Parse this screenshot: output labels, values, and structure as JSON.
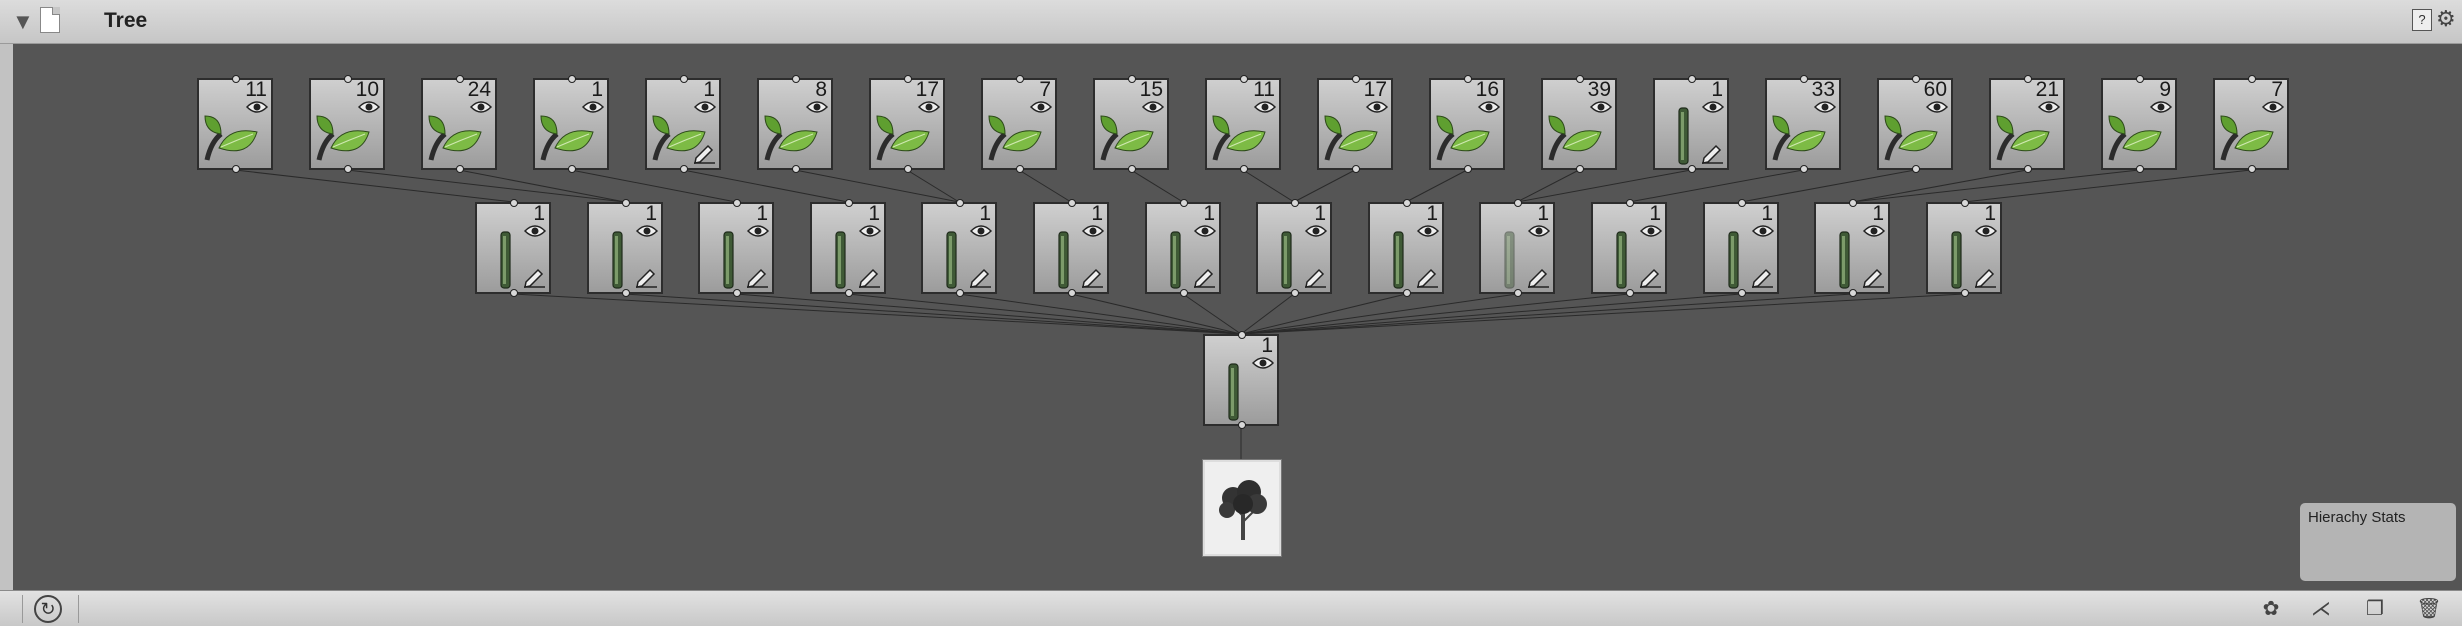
{
  "header": {
    "title": "Tree",
    "foldout_glyph": "▼",
    "help_glyph": "?",
    "gear_glyph": "⚙"
  },
  "stats": {
    "label": "Hierachy Stats"
  },
  "footer": {
    "refresh_glyph": "↻",
    "tools": [
      {
        "name": "add-leaf-group-icon",
        "glyph": "✿"
      },
      {
        "name": "add-branch-group-icon",
        "glyph": "⋌"
      },
      {
        "name": "duplicate-icon",
        "glyph": "❐"
      },
      {
        "name": "delete-icon",
        "glyph": "🗑"
      }
    ]
  },
  "leaf_row": [
    {
      "count": "11",
      "type": "leaf"
    },
    {
      "count": "10",
      "type": "leaf"
    },
    {
      "count": "24",
      "type": "leaf"
    },
    {
      "count": "1",
      "type": "leaf"
    },
    {
      "count": "1",
      "type": "leaf",
      "edited": true
    },
    {
      "count": "8",
      "type": "leaf"
    },
    {
      "count": "17",
      "type": "leaf"
    },
    {
      "count": "7",
      "type": "leaf"
    },
    {
      "count": "15",
      "type": "leaf"
    },
    {
      "count": "11",
      "type": "leaf"
    },
    {
      "count": "17",
      "type": "leaf"
    },
    {
      "count": "16",
      "type": "leaf"
    },
    {
      "count": "39",
      "type": "leaf"
    },
    {
      "count": "1",
      "type": "branch",
      "edited": true
    },
    {
      "count": "33",
      "type": "leaf"
    },
    {
      "count": "60",
      "type": "leaf"
    },
    {
      "count": "21",
      "type": "leaf"
    },
    {
      "count": "9",
      "type": "leaf"
    },
    {
      "count": "7",
      "type": "leaf"
    }
  ],
  "branch_row": [
    {
      "count": "1"
    },
    {
      "count": "1"
    },
    {
      "count": "1"
    },
    {
      "count": "1"
    },
    {
      "count": "1"
    },
    {
      "count": "1"
    },
    {
      "count": "1"
    },
    {
      "count": "1"
    },
    {
      "count": "1"
    },
    {
      "count": "1",
      "faded": true
    },
    {
      "count": "1"
    },
    {
      "count": "1"
    },
    {
      "count": "1"
    },
    {
      "count": "1"
    }
  ],
  "trunk": {
    "count": "1"
  },
  "colors": {
    "canvas": "#555555",
    "leaf": "#6fae3a",
    "bark": "#3f5a36"
  }
}
